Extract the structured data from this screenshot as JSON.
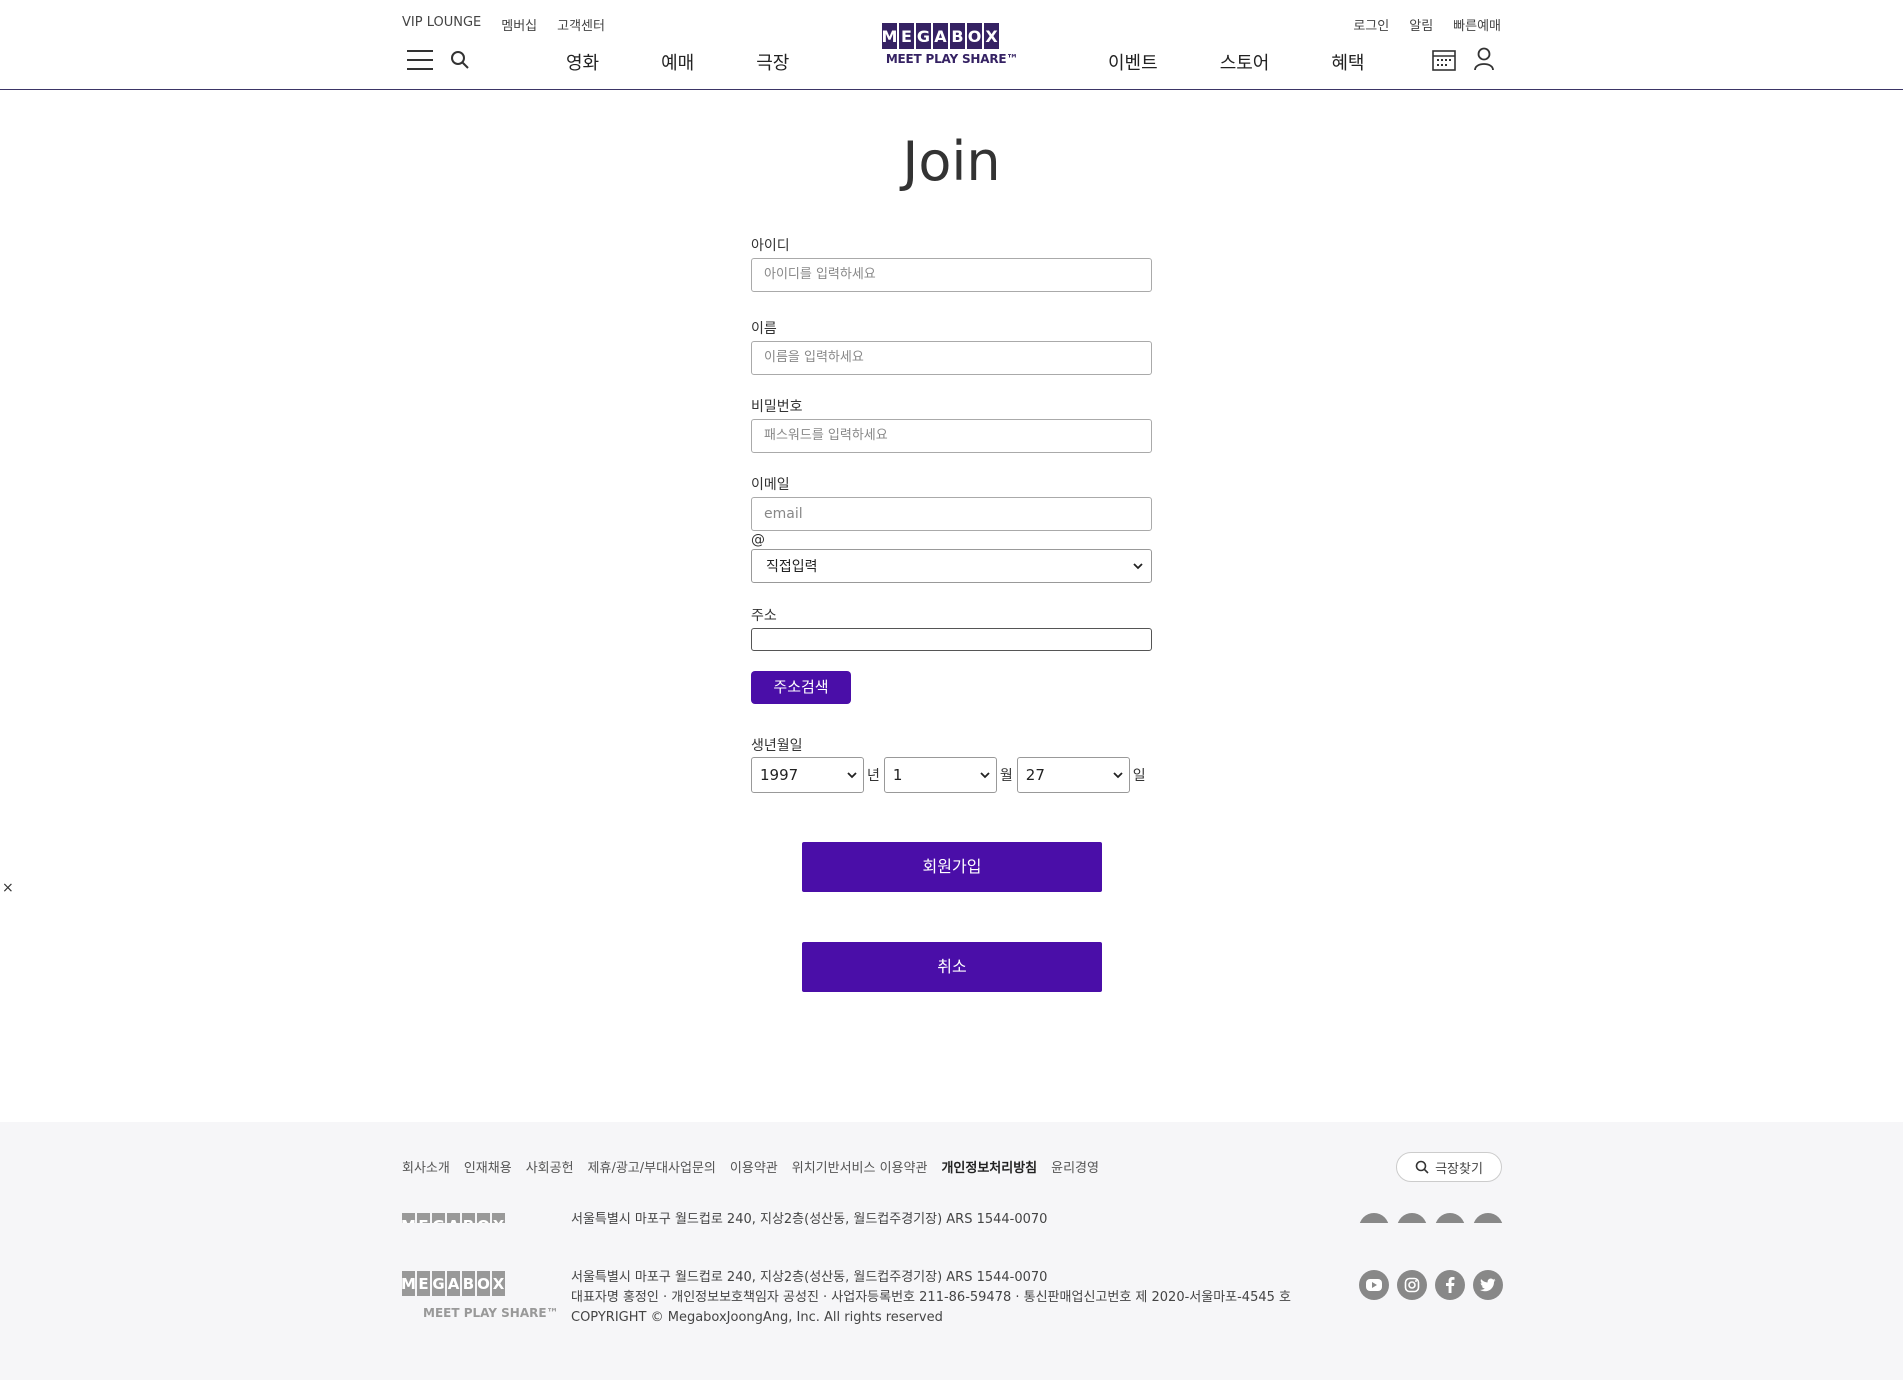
{
  "header": {
    "util_left": [
      "VIP LOUNGE",
      "멤버십",
      "고객센터"
    ],
    "util_right": [
      "로그인",
      "알림",
      "빠른예매"
    ],
    "nav_left": [
      "영화",
      "예매",
      "극장"
    ],
    "nav_right": [
      "이벤트",
      "스토어",
      "혜택"
    ],
    "logo_letters": [
      "M",
      "E",
      "G",
      "A",
      "B",
      "O",
      "X"
    ],
    "logo_tagline": "MEET PLAY SHARE™"
  },
  "page": {
    "title": "Join"
  },
  "form": {
    "id_label": "아이디",
    "id_placeholder": "아이디를 입력하세요",
    "name_label": "이름",
    "name_placeholder": "이름을 입력하세요",
    "password_label": "비밀번호",
    "password_placeholder": "패스워드를 입력하세요",
    "email_label": "이메일",
    "email_placeholder": "email",
    "at_sign": "@",
    "email_domain_selected": "직접입력",
    "address_label": "주소",
    "address_value": "",
    "address_search_button": "주소검색",
    "birth_label": "생년월일",
    "birth_year": "1997",
    "birth_year_unit": "년",
    "birth_month": "1",
    "birth_month_unit": "월",
    "birth_day": "27",
    "birth_day_unit": "일",
    "submit_button": "회원가입",
    "cancel_button": "취소"
  },
  "close_label": "×",
  "footer": {
    "links": [
      "회사소개",
      "인재채용",
      "사회공헌",
      "제휴/광고/부대사업문의",
      "이용약관",
      "위치기반서비스 이용약관",
      "개인정보처리방침",
      "윤리경영"
    ],
    "bold_link_index": 6,
    "theater_search": "극장찾기",
    "address_line_top": "서울특별시 마포구 월드컵로 240, 지상2층(성산동, 월드컵주경기장) ARS 1544-0070",
    "address_line1": "서울특별시 마포구 월드컵로 240, 지상2층(성산동, 월드컵주경기장) ARS 1544-0070",
    "address_line2": "대표자명 홍정인 · 개인정보보호책임자 공성진 · 사업자등록번호 211-86-59478 · 통신판매업신고번호 제 2020-서울마포-4545 호",
    "address_line3": "COPYRIGHT © MegaboxJoongAng, Inc. All rights reserved",
    "logo_tagline": "MEET PLAY SHARE™",
    "social_icons": [
      "youtube-icon",
      "instagram-icon",
      "facebook-icon",
      "twitter-icon"
    ]
  }
}
